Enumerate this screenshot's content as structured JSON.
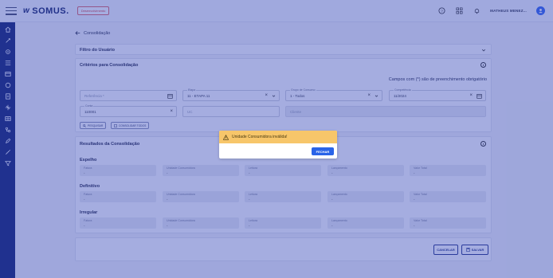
{
  "topbar": {
    "logo": "SOMUS.",
    "env_badge": "Desenvolvimento",
    "user_name": "MATHEUS MENEZ...",
    "user_initial": "U"
  },
  "page": {
    "back_label": "Consolidação"
  },
  "filtro": {
    "title": "Filtro do Usuário"
  },
  "criterios": {
    "title": "Critérios para Consolidação",
    "required_note": "Campos com (*) são de preenchimento obrigatório",
    "referencia": {
      "placeholder": "Referência *"
    },
    "etapa": {
      "label": "Etapa",
      "value": "11 - ETAPA 11"
    },
    "grupo": {
      "label": "Grupo de Consumo",
      "value": "1 - Todos"
    },
    "competencia": {
      "label": "Competência",
      "value": "11/2024"
    },
    "conta": {
      "label": "Conta",
      "value": "110001"
    },
    "uc": {
      "placeholder": "UC"
    },
    "cliente": {
      "placeholder": "Cliente"
    },
    "btn_pesquisar": "PESQUISAR",
    "btn_consolidar": "CONSOLIDAR TODOS"
  },
  "resultados": {
    "title": "Resultados da Consolidação",
    "column_labels": [
      "Fatura",
      "Unidade Consumidora",
      "Leitura",
      "Lançamento",
      "Valor Total"
    ],
    "empty_value": "-",
    "sections": [
      {
        "title": "Espelho"
      },
      {
        "title": "Definitivo"
      },
      {
        "title": "Irregular"
      }
    ]
  },
  "footer": {
    "cancel": "CANCELAR",
    "save": "SALVAR"
  },
  "modal": {
    "message": "Unidade Consumidora inválida!",
    "button": "FECHAR"
  },
  "colors": {
    "sidebar": "#1b2a74",
    "overlay": "rgba(40,60,180,0.42)",
    "modal_header": "#f7c66a",
    "primary_button": "#2a64e8"
  }
}
